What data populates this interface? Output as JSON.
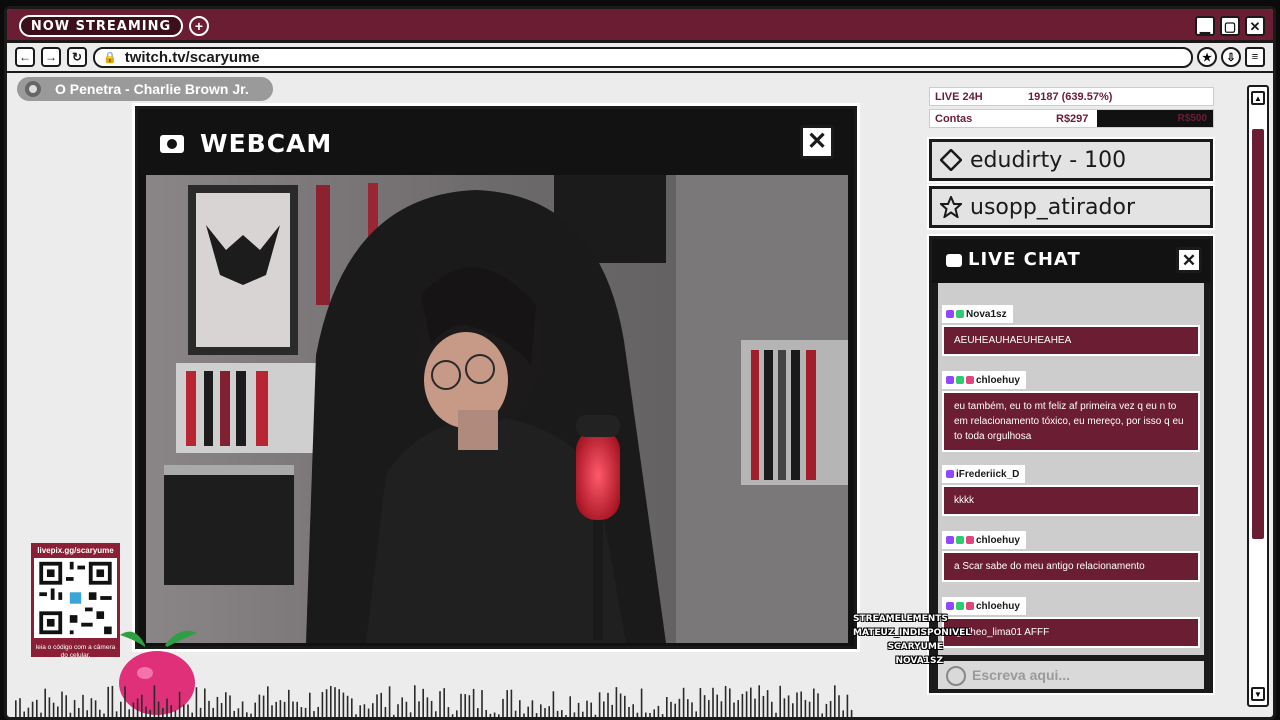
{
  "titlebar": {
    "pill_label": "NOW STREAMING",
    "new_tab_glyph": "+",
    "controls": {
      "minimize": "▁",
      "maximize": "▢",
      "close": "✕"
    }
  },
  "address": {
    "back": "←",
    "forward": "→",
    "reload": "↻",
    "url": "twitch.tv/scaryume",
    "tools": [
      "star-icon",
      "download-icon",
      "menu-icon"
    ]
  },
  "now_playing": {
    "song": "O Penetra - Charlie Brown Jr."
  },
  "webcam": {
    "title": "WEBCAM",
    "close": "✕"
  },
  "stats": {
    "live_label": "LIVE 24H",
    "live_value": "19187 (639.57%)",
    "bills_label": "Contas",
    "bills_value": "R$297",
    "bills_goal": "R$500",
    "bills_progress": 0.594
  },
  "top_users": [
    {
      "name": "edudirty - 100",
      "icon": "diamond-icon"
    },
    {
      "name": "usopp_atirador",
      "icon": "star-icon"
    }
  ],
  "chat": {
    "title": "LIVE CHAT",
    "close": "✕",
    "messages": [
      {
        "user": "Nova1sz",
        "text": "AEUHEAUHAEUHEAHEA"
      },
      {
        "user": "chloehuy",
        "text": "eu também, eu to mt feliz af primeira vez q eu n to em relacionamento tóxico, eu mereço, por isso q eu to toda orgulhosa"
      },
      {
        "user": "iFrederiick_D",
        "text": "kkkk"
      },
      {
        "user": "chloehuy",
        "text": "a Scar sabe do meu antigo relacionamento"
      },
      {
        "user": "chloehuy",
        "text": "@Theo_lima01 AFFF"
      }
    ],
    "input_placeholder": "Escreva aqui..."
  },
  "qr": {
    "top": "livepix.gg/scaryume",
    "bottom": "leia o código com a câmera do celular."
  },
  "viewers": [
    "STREAMELEMENTS",
    "MATEUZ_INDISPONIVEL",
    "SCARYUME",
    "NOVA1SZ"
  ],
  "colors": {
    "accent": "#6b1d34",
    "frame": "#1a1a1a",
    "panel": "#ececec"
  }
}
